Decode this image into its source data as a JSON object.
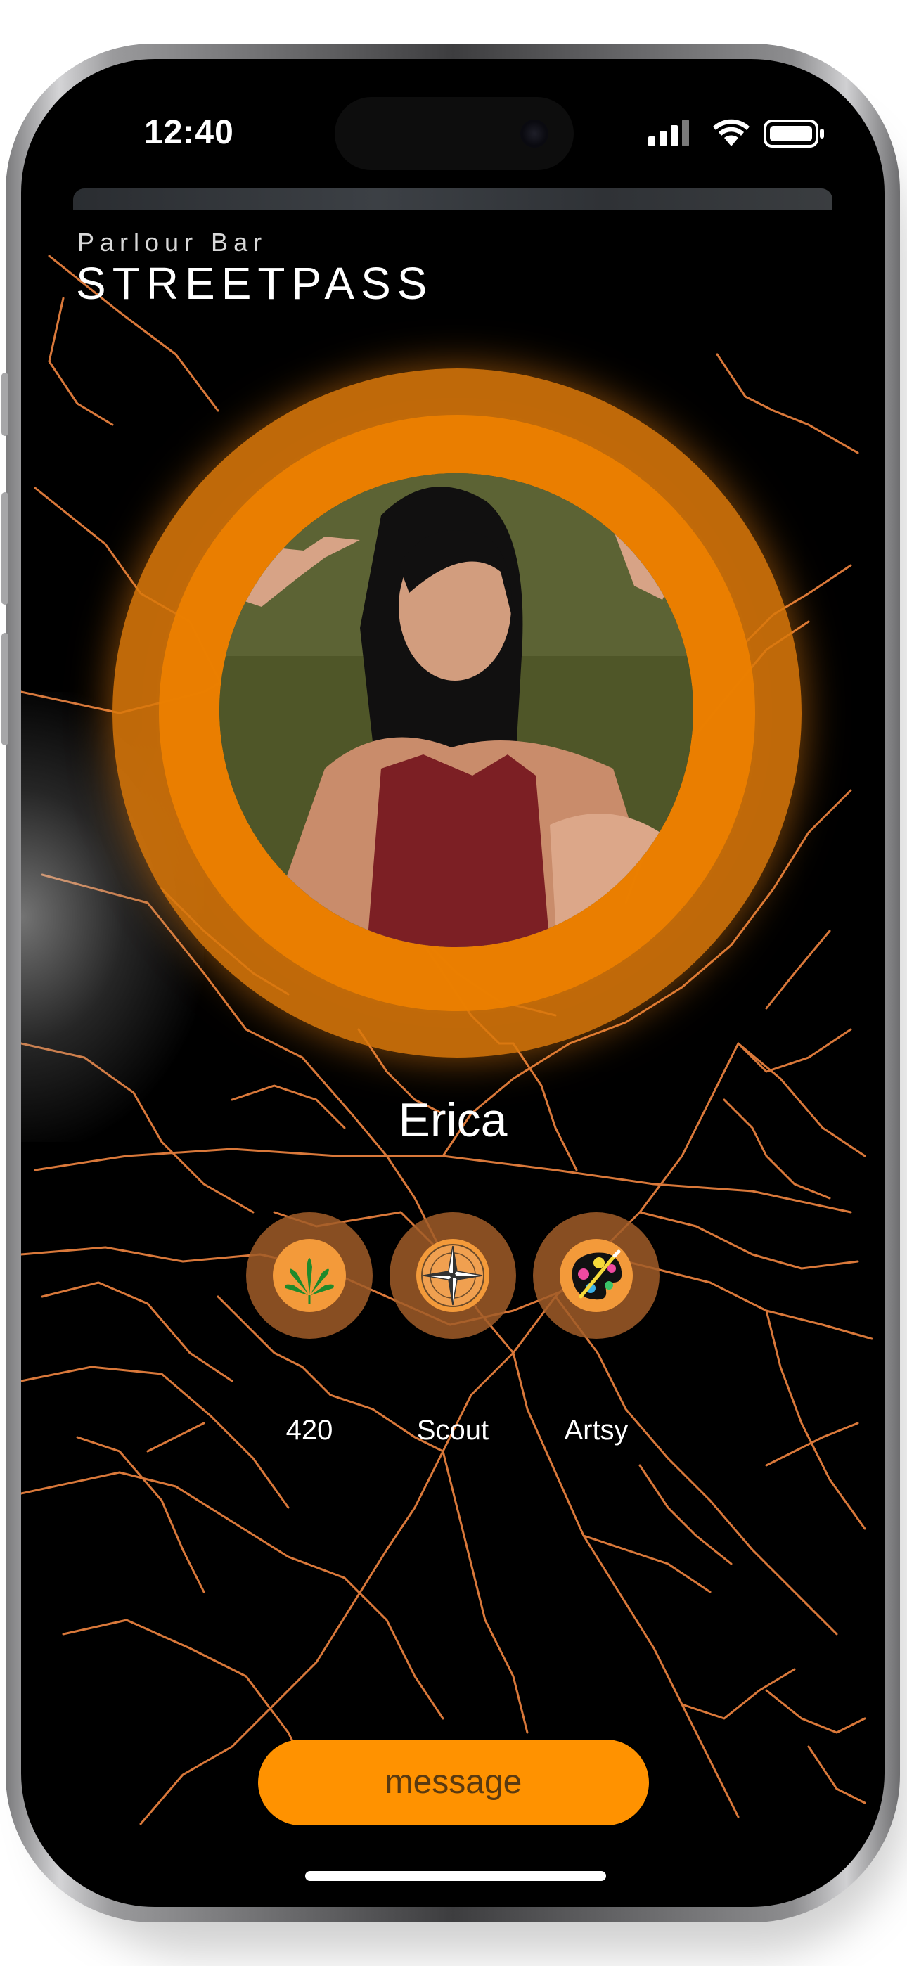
{
  "status_bar": {
    "time": "12:40"
  },
  "header": {
    "venue": "Parlour Bar",
    "title": "STREETPASS"
  },
  "profile": {
    "name": "Erica",
    "avatar_icon": "profile-photo"
  },
  "badges": [
    {
      "label": "420",
      "icon": "cannabis-leaf-icon"
    },
    {
      "label": "Scout",
      "icon": "compass-rose-icon"
    },
    {
      "label": "Artsy",
      "icon": "paint-palette-icon"
    }
  ],
  "actions": {
    "message_label": "message"
  },
  "colors": {
    "accent": "#ff9200",
    "ring_outer": "#da780a",
    "ring_inner": "#ec8000",
    "map_lines": "#d9783a",
    "background": "#000000"
  }
}
